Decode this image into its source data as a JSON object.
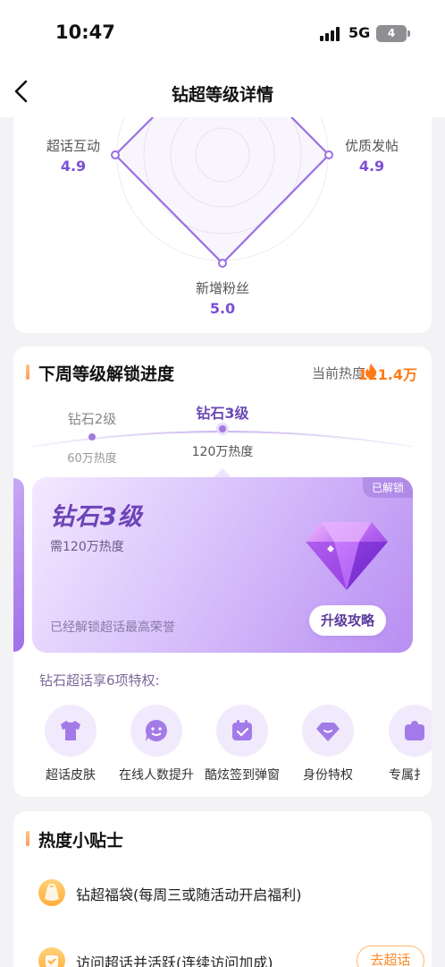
{
  "status_bar": {
    "time": "10:47",
    "network": "5G",
    "battery": "4"
  },
  "nav": {
    "title": "钻超等级详情"
  },
  "radar": {
    "axes": [
      {
        "label": "超话互动",
        "value": "4.9"
      },
      {
        "label": "优质发帖",
        "value": "4.9"
      },
      {
        "label": "新增粉丝",
        "value": "5.0"
      }
    ]
  },
  "progress": {
    "title": "下周等级解锁进度",
    "heat_label": "当前热度",
    "heat_value": "121.4万",
    "levels": [
      {
        "name": "钻石2级",
        "heat": "60万热度"
      },
      {
        "name": "钻石3级",
        "heat": "120万热度"
      }
    ],
    "card": {
      "tag": "已解锁",
      "title": "钻石3级",
      "need": "需120万热度",
      "honor": "已经解锁超话最高荣誉",
      "button": "升级攻略"
    },
    "privileges_title": "钻石超话享6项特权:",
    "privileges": [
      {
        "label": "超话皮肤",
        "icon": "shirt-icon"
      },
      {
        "label": "在线人数提升",
        "icon": "smile-icon"
      },
      {
        "label": "酷炫签到弹窗",
        "icon": "calendar-check-icon"
      },
      {
        "label": "身份特权",
        "icon": "diamond-icon"
      },
      {
        "label": "专属扌",
        "icon": "badge-icon"
      }
    ]
  },
  "tips": {
    "title": "热度小贴士",
    "items": [
      {
        "text": "钻超福袋(每周三或随活动开启福利)"
      },
      {
        "text": "访问超话并活跃(连续访问加成)",
        "button": "去超话"
      }
    ]
  },
  "colors": {
    "accent": "#7c4fd6",
    "heat": "#ff7a1a",
    "tip_accent": "#ffa05a"
  }
}
